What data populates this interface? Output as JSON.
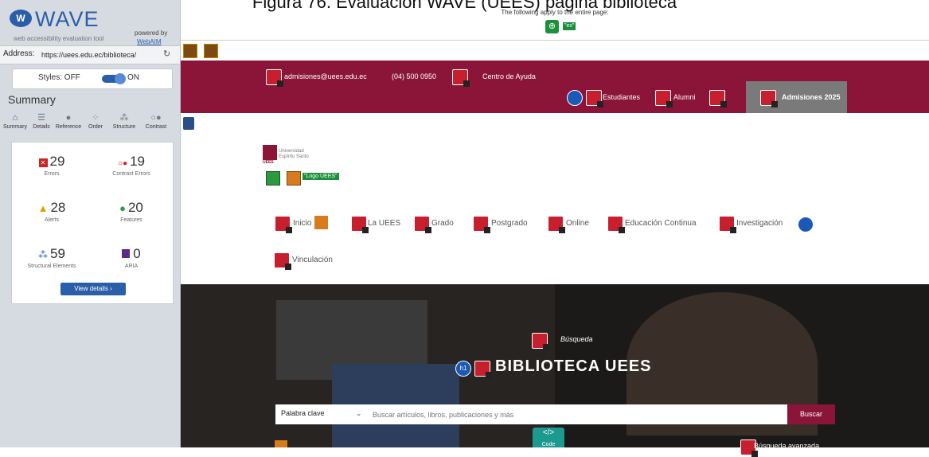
{
  "caption": "Figura 76. Evaluación WAVE (UEES) página biblioteca",
  "wave": {
    "brand": "WAVE",
    "tagline": "web accessibility evaluation tool",
    "powered_by": "powered by",
    "webaim": "WebAIM",
    "address_label": "Address:",
    "address_value": "https://uees.edu.ec/biblioteca/",
    "styles_label": "Styles:  OFF",
    "styles_on": "ON",
    "summary_title": "Summary",
    "tabs": [
      {
        "label": "Summary",
        "icon": "home-icon"
      },
      {
        "label": "Details",
        "icon": "list-icon"
      },
      {
        "label": "Reference",
        "icon": "info-icon"
      },
      {
        "label": "Order",
        "icon": "order-icon"
      },
      {
        "label": "Structure",
        "icon": "structure-icon"
      },
      {
        "label": "Contrast",
        "icon": "contrast-icon"
      }
    ],
    "stats": {
      "errors": {
        "value": "29",
        "label": "Errors"
      },
      "contrast": {
        "value": "19",
        "label": "Contrast Errors"
      },
      "alerts": {
        "value": "28",
        "label": "Alerts"
      },
      "features": {
        "value": "20",
        "label": "Features"
      },
      "structural": {
        "value": "59",
        "label": "Structural Elements"
      },
      "aria": {
        "value": "0",
        "label": "ARIA"
      }
    },
    "view_details": "View details ›",
    "colors": {
      "brand": "#2b5ea8",
      "error": "#cc2222",
      "alert": "#e2a100",
      "feature": "#2d9a40",
      "aria": "#5a2a8a"
    }
  },
  "page_top": {
    "applies": "The following apply to the entire page:",
    "lang_tag": "\"es\""
  },
  "header": {
    "email": "admisiones@uees.edu.ec",
    "phone": "(04) 500 0950",
    "help": "Centro de Ayuda",
    "students": "Estudiantes",
    "alumni": "Alumni",
    "admissions": "Admisiones 2025",
    "color": "#8a1538"
  },
  "logo": {
    "text": "Universidad Espíritu Santo",
    "abbr": "UEES",
    "alt_tag": "\"Logo UEES\""
  },
  "nav": {
    "items": [
      "Inicio",
      "La UEES",
      "Grado",
      "Postgrado",
      "Online",
      "Educación Continua",
      "Investigación"
    ],
    "second_row": "Vinculación"
  },
  "hero": {
    "busqueda": "Búsqueda",
    "title": "BIBLIOTECA UEES",
    "select_value": "Palabra clave",
    "placeholder": "Buscar artículos, libros, publicaciones y más",
    "button": "Buscar",
    "code": "Code",
    "advanced": "Búsqueda avanzada"
  }
}
